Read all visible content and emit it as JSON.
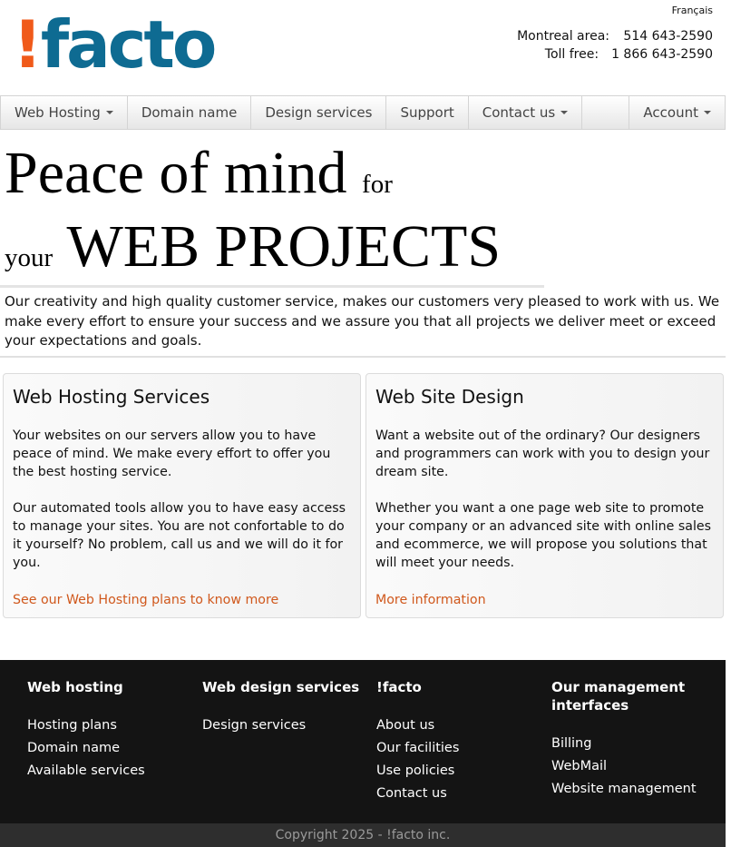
{
  "header": {
    "language_link": "Français",
    "logo": {
      "bang": "!",
      "word": "facto"
    },
    "phones": [
      {
        "label": "Montreal area:",
        "number": "514 643-2590"
      },
      {
        "label": "Toll free:",
        "number": "1 866 643-2590"
      }
    ]
  },
  "nav": {
    "items": [
      "Web Hosting",
      "Domain name",
      "Design services",
      "Support",
      "Contact us"
    ],
    "account": "Account"
  },
  "hero": {
    "line1_big": "Peace of mind",
    "line1_small": "for",
    "line2_small": "your",
    "line2_big": "WEB PROJECTS"
  },
  "intro": "Our creativity and high quality customer service, makes our customers very pleased to work with us. We make every effort to ensure your success and we assure you that all projects we deliver meet or exceed your expectations and goals.",
  "panels": [
    {
      "title": "Web Hosting Services",
      "paragraphs": [
        "Your websites on our servers allow you to have peace of mind. We make every effort to offer you the best hosting service.",
        "Our automated tools allow you to have easy access to manage your sites. You are not confortable to do it yourself? No problem, call us and we will do it for you."
      ],
      "link": "See our Web Hosting plans to know more"
    },
    {
      "title": "Web Site Design",
      "paragraphs": [
        "Want a website out of the ordinary? Our designers and programmers can work with you to design your dream site.",
        "Whether you want a one page web site to promote your company or an advanced site with online sales and ecommerce, we will propose you solutions that will meet your needs."
      ],
      "link": "More information"
    }
  ],
  "footer": {
    "columns": [
      {
        "title": "Web hosting",
        "links": [
          "Hosting plans",
          "Domain name",
          "Available services"
        ]
      },
      {
        "title": "Web design services",
        "links": [
          "Design services"
        ]
      },
      {
        "title": "!facto",
        "links": [
          "About us",
          "Our facilities",
          "Use policies",
          "Contact us"
        ]
      },
      {
        "title": "Our management interfaces",
        "links": [
          "Billing",
          "WebMail",
          "Website management"
        ]
      }
    ],
    "copyright": "Copyright 2025 - !facto inc."
  },
  "colors": {
    "brand_orange": "#f05a1a",
    "brand_blue": "#0e6b92",
    "link": "#d0581c",
    "footer_bg": "#141414"
  }
}
